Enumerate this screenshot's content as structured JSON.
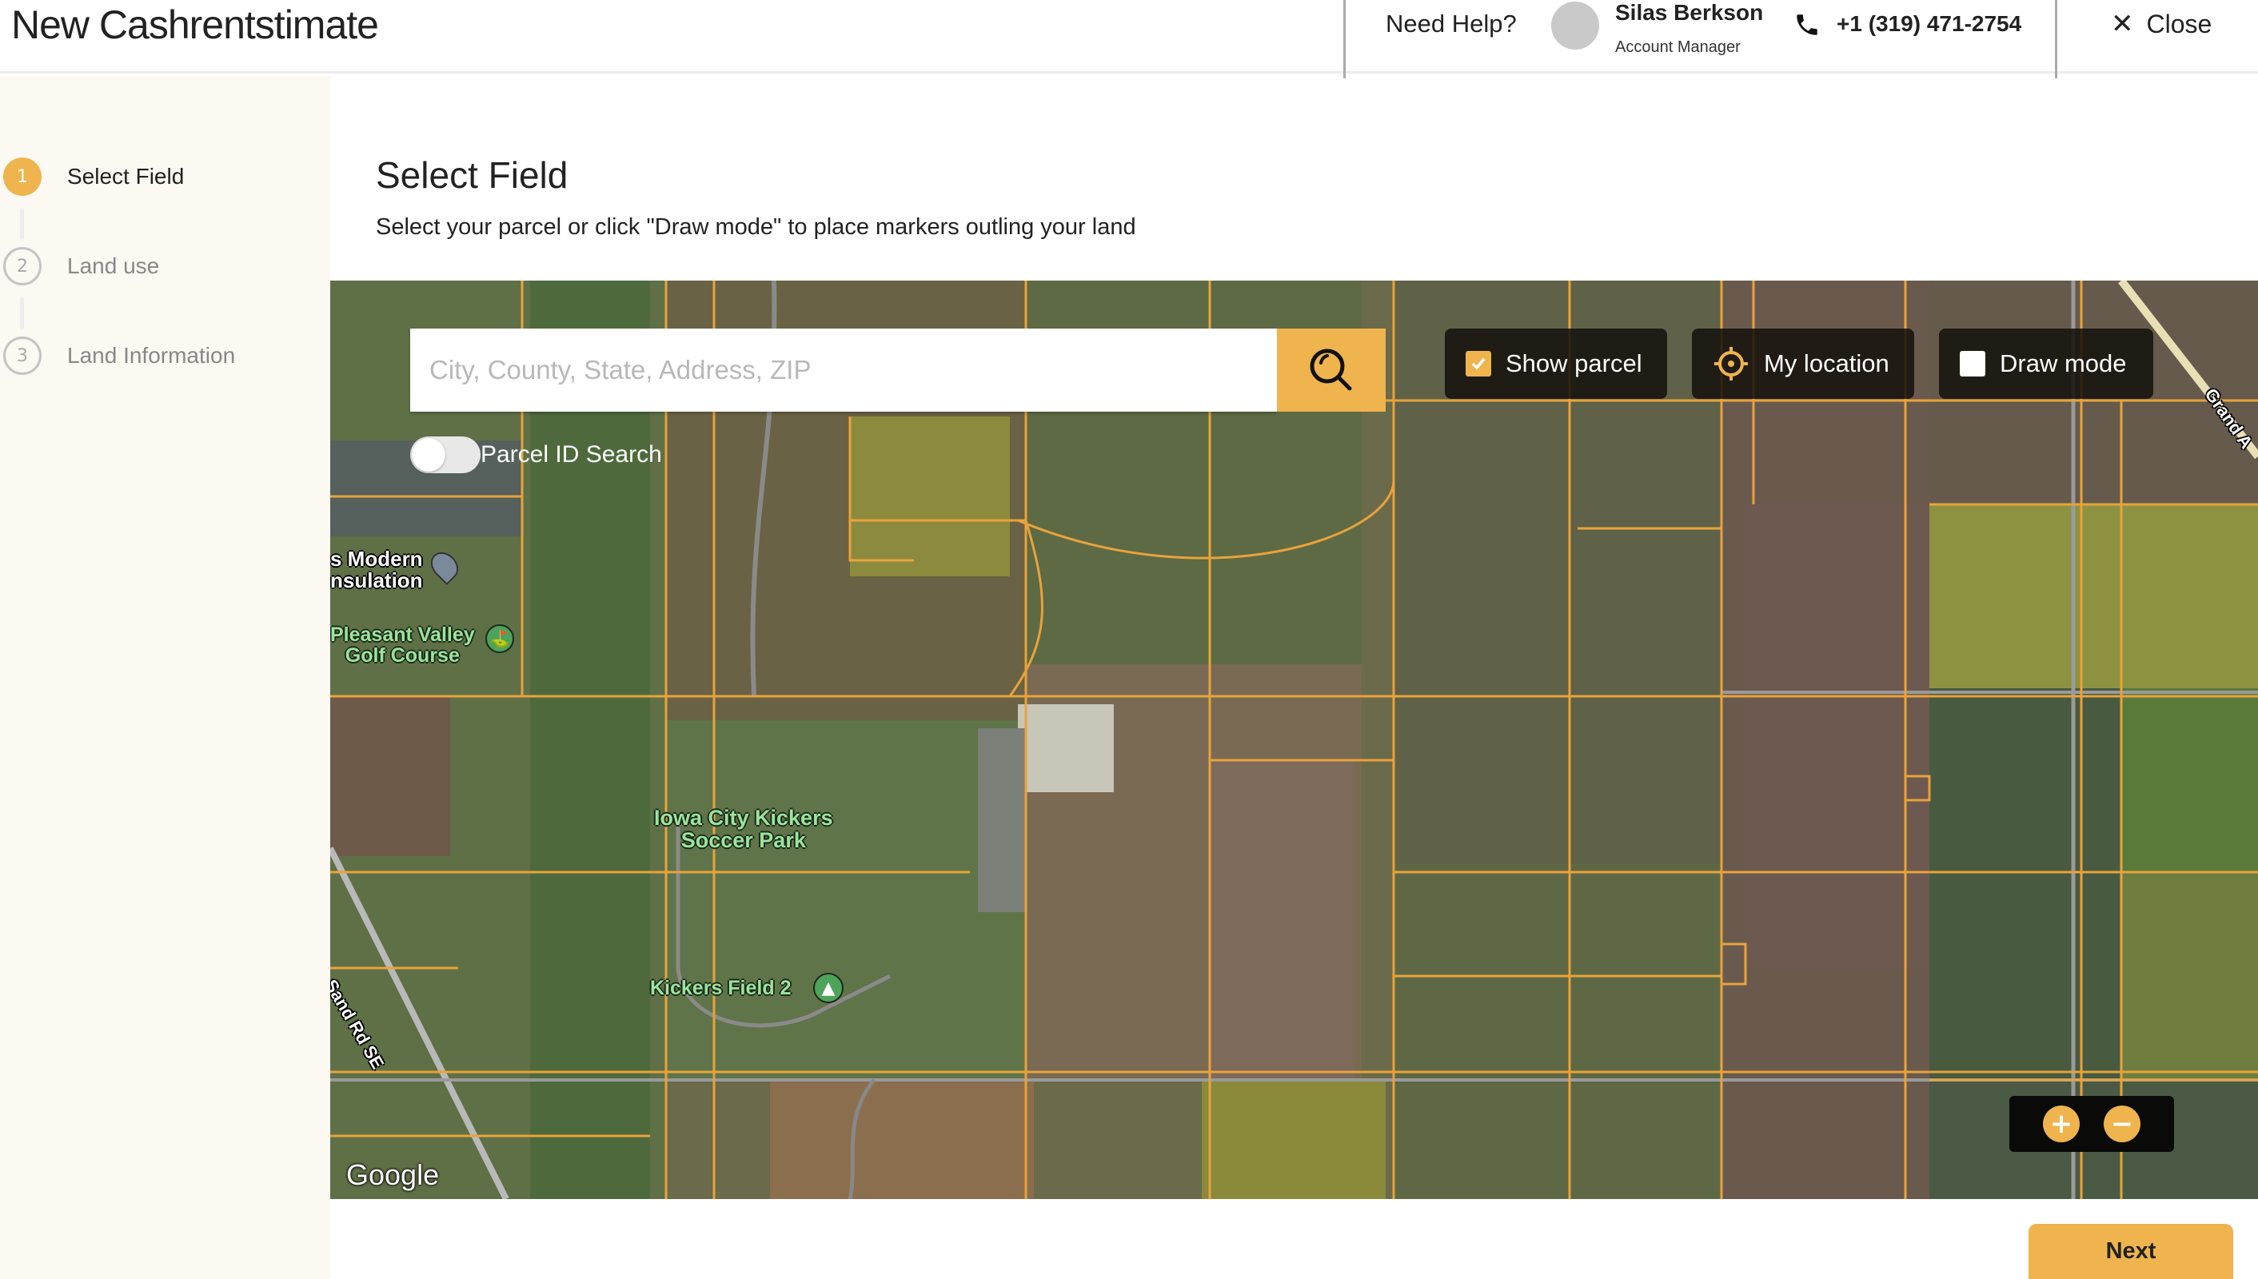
{
  "header": {
    "app_title": "New Cashrentstimate",
    "need_help": "Need Help?",
    "manager": {
      "name": "Silas Berkson",
      "role": "Account Manager",
      "phone": "+1 (319) 471-2754",
      "avatar_icon": "avatar-placeholder"
    },
    "close_label": "Close",
    "close_icon": "close-icon"
  },
  "sidebar": {
    "steps": [
      {
        "number": "1",
        "label": "Select Field",
        "state": "active"
      },
      {
        "number": "2",
        "label": "Land use",
        "state": "inactive"
      },
      {
        "number": "3",
        "label": "Land Information",
        "state": "inactive"
      }
    ]
  },
  "main": {
    "title": "Select Field",
    "subtitle": "Select your parcel or click \"Draw mode\" to place markers outling your land"
  },
  "map": {
    "search": {
      "placeholder": "City, County, State, Address, ZIP",
      "value": "",
      "button_icon": "search-icon"
    },
    "parcel_id_toggle": {
      "label": "Parcel ID Search",
      "on": false
    },
    "controls": {
      "show_parcel": {
        "label": "Show parcel",
        "checked": true
      },
      "my_location": {
        "label": "My location",
        "icon": "crosshair-icon"
      },
      "draw_mode": {
        "label": "Draw mode",
        "checked": false
      }
    },
    "zoom": {
      "in_label": "+",
      "out_label": "−"
    },
    "attribution": "Google",
    "labels": {
      "modern_insulation_1": "s Modern",
      "modern_insulation_2": "nsulation",
      "golf_1": "Pleasant Valley",
      "golf_2": "Golf Course",
      "kickers_1": "Iowa City Kickers",
      "kickers_2": "Soccer Park",
      "kickers_field": "Kickers Field 2",
      "sand_rd": "Sand Rd SE",
      "grand": "Grand A"
    },
    "colors": {
      "parcel_line": "#e8a33c",
      "accent": "#efb44e"
    }
  },
  "footer": {
    "next_label": "Next"
  }
}
